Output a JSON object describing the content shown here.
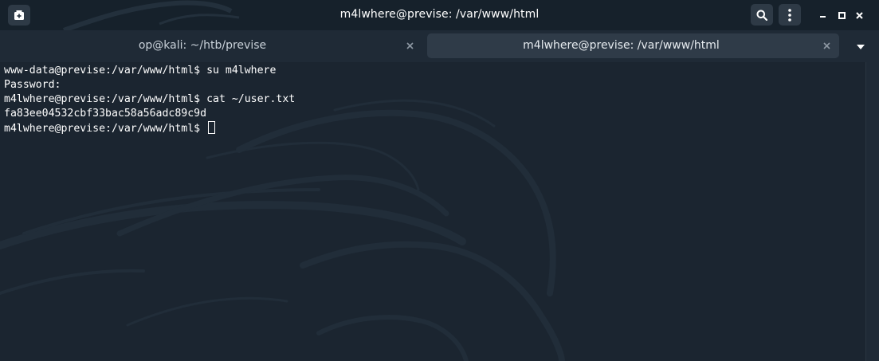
{
  "window": {
    "title": "m4lwhere@previse: /var/www/html"
  },
  "titlebar": {
    "new_tab_icon": "new-tab-icon",
    "search_icon": "search-icon",
    "menu_icon": "kebab-menu-icon",
    "minimize_icon": "minimize-icon",
    "maximize_icon": "maximize-icon",
    "close_icon": "close-icon"
  },
  "tabs": [
    {
      "label": "op@kali: ~/htb/previse",
      "active": false
    },
    {
      "label": "m4lwhere@previse: /var/www/html",
      "active": true
    }
  ],
  "terminal": {
    "lines": [
      "www-data@previse:/var/www/html$ su m4lwhere",
      "Password:",
      "m4lwhere@previse:/var/www/html$ cat ~/user.txt",
      "fa83ee04532cbf33bac58a56adc89c9d",
      "m4lwhere@previse:/var/www/html$ "
    ]
  },
  "colors": {
    "background": "#1b2530",
    "titlebar": "#16212b",
    "tabbar": "#1f2a36",
    "active_tab": "#2f3b48",
    "text": "#ffffff"
  }
}
